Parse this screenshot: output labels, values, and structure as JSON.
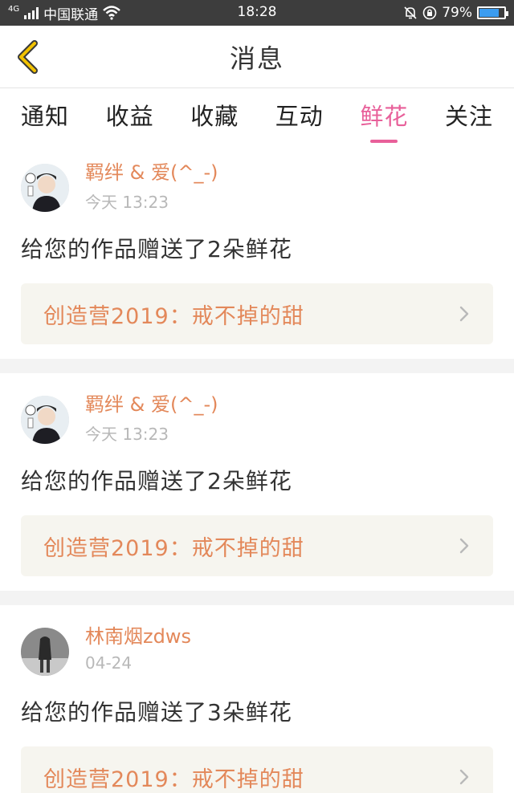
{
  "status_bar": {
    "network": "4G",
    "carrier": "中国联通",
    "time": "18:28",
    "battery": "79%",
    "battery_level": 0.79
  },
  "header": {
    "title": "消息"
  },
  "tabs": [
    {
      "label": "通知"
    },
    {
      "label": "收益"
    },
    {
      "label": "收藏"
    },
    {
      "label": "互动"
    },
    {
      "label": "鲜花",
      "active": true
    },
    {
      "label": "关注"
    }
  ],
  "messages": [
    {
      "user": "羁绊 & 爱(^_-)",
      "time": "今天 13:23",
      "text": "给您的作品赠送了2朵鲜花",
      "work": "创造营2019：戒不掉的甜"
    },
    {
      "user": "羁绊 & 爱(^_-)",
      "time": "今天 13:23",
      "text": "给您的作品赠送了2朵鲜花",
      "work": "创造营2019：戒不掉的甜"
    },
    {
      "user": "林南烟zdws",
      "time": "04-24",
      "text": "给您的作品赠送了3朵鲜花",
      "work": "创造营2019：戒不掉的甜"
    }
  ],
  "colors": {
    "accent": "#e8609a",
    "username": "#e3885a",
    "back_arrow": "#f2c200"
  }
}
